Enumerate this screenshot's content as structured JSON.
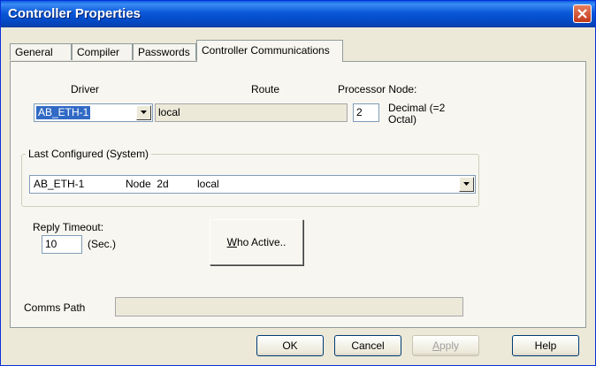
{
  "window": {
    "title": "Controller Properties"
  },
  "tabs": [
    "General",
    "Compiler",
    "Passwords",
    "Controller Communications"
  ],
  "driver": {
    "label": "Driver",
    "value": "AB_ETH-1"
  },
  "route": {
    "label": "Route",
    "value": "local"
  },
  "processor_node": {
    "label": "Processor Node:",
    "value": "2",
    "note_line1": "Decimal (=2",
    "note_line2": "Octal)"
  },
  "last_configured": {
    "title": "Last Configured (System)",
    "driver": "AB_ETH-1",
    "node": "Node  2d",
    "route": "local"
  },
  "reply_timeout": {
    "label": "Reply Timeout:",
    "value": "10",
    "unit": "(Sec.)"
  },
  "who_active": {
    "label_first": "W",
    "label_rest": "ho Active.."
  },
  "comms_path": {
    "label": "Comms Path",
    "value": ""
  },
  "buttons": {
    "ok": "OK",
    "cancel": "Cancel",
    "apply_first": "A",
    "apply_rest": "pply",
    "help": "Help"
  },
  "colors": {
    "titlebar": "#0a57d9",
    "selection": "#316ac5",
    "face": "#ece9d8"
  }
}
